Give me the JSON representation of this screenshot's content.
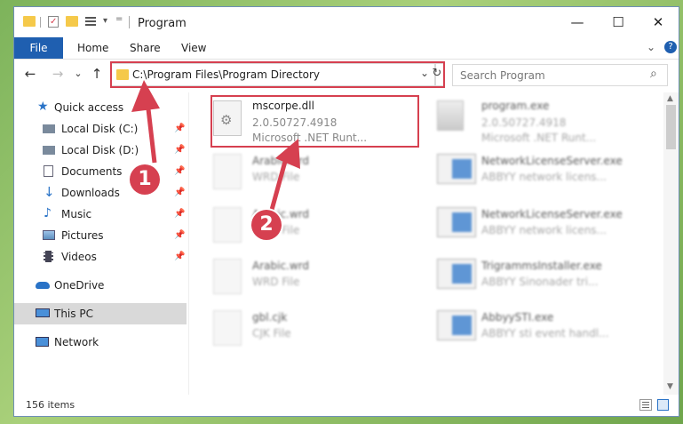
{
  "window": {
    "title": "Program",
    "min_glyph": "—",
    "max_glyph": "☐",
    "close_glyph": "✕"
  },
  "ribbon": {
    "file": "File",
    "tabs": [
      "Home",
      "Share",
      "View"
    ],
    "help_glyph": "?",
    "collapse_glyph": "⌄"
  },
  "navigation": {
    "back_glyph": "←",
    "forward_glyph": "→",
    "recent_glyph": "⌄",
    "up_glyph": "↑",
    "address": "C:\\Program Files\\Program Directory",
    "address_dropdown_glyph": "⌄",
    "refresh_glyph": "↻",
    "search_placeholder": "Search Program",
    "search_glyph": "⌕"
  },
  "sidebar": {
    "quick_access": "Quick access",
    "pinned": [
      {
        "label": "Local Disk (C:)",
        "icon": "drive-icon"
      },
      {
        "label": "Local Disk (D:)",
        "icon": "drive-icon"
      },
      {
        "label": "Documents",
        "icon": "documents-icon"
      },
      {
        "label": "Downloads",
        "icon": "downloads-icon"
      },
      {
        "label": "Music",
        "icon": "music-icon"
      },
      {
        "label": "Pictures",
        "icon": "pictures-icon"
      },
      {
        "label": "Videos",
        "icon": "videos-icon"
      }
    ],
    "pin_glyph": "📌",
    "onedrive": "OneDrive",
    "this_pc": "This PC",
    "network": "Network"
  },
  "files": {
    "left": [
      {
        "name": "mscorpe.dll",
        "line1": "2.0.50727.4918",
        "line2": "Microsoft .NET Runt..."
      },
      {
        "name": "Arabic.wrd",
        "line1": "WRD File"
      },
      {
        "name": "Arabic.wrd",
        "line1": "WRD File"
      },
      {
        "name": "Arabic.wrd",
        "line1": "WRD File"
      },
      {
        "name": "gbl.cjk",
        "line1": "CJK File"
      }
    ],
    "right": [
      {
        "name": "program.exe",
        "line1": "2.0.50727.4918",
        "line2": "Microsoft .NET Runt..."
      },
      {
        "name": "NetworkLicenseServer.exe",
        "line1": "ABBYY network licens..."
      },
      {
        "name": "NetworkLicenseServer.exe",
        "line1": "ABBYY network licens..."
      },
      {
        "name": "TrigrammsInstaller.exe",
        "line1": "ABBYY Sinonader tri..."
      },
      {
        "name": "AbbyySTI.exe",
        "line1": "ABBYY sti event handl..."
      }
    ]
  },
  "status": {
    "item_count": "156 items"
  },
  "annotations": {
    "marker1": "1",
    "marker2": "2",
    "color": "#d64050"
  },
  "colors": {
    "file_tab": "#1f5fb0",
    "selection": "#d9d9d9",
    "folder": "#f5c94a"
  }
}
